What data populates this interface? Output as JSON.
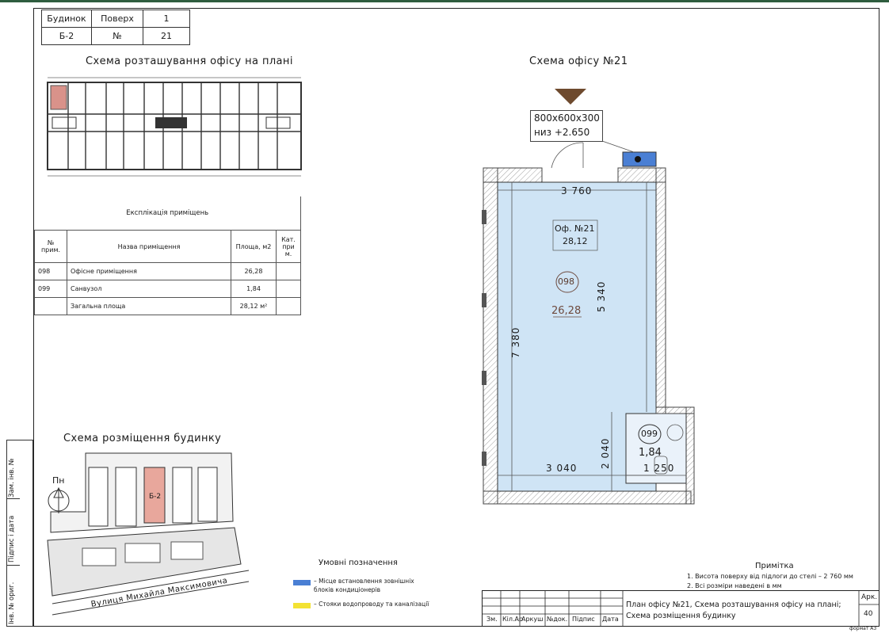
{
  "header": {
    "building_label": "Будинок",
    "building_value": "Б-2",
    "floor_label": "Поверх",
    "floor_value": "1",
    "number_label": "№",
    "number_value": "21"
  },
  "titles": {
    "floor_scheme": "Схема розташування офісу на плані",
    "office_scheme": "Схема офісу №21",
    "building_scheme": "Схема розміщення будинку"
  },
  "explication": {
    "caption": "Експлікація приміщень",
    "col_num": "№ прим.",
    "col_name": "Назва приміщення",
    "col_area": "Площа, м2",
    "col_cat": "Кат. при м.",
    "rows": [
      {
        "num": "098",
        "name": "Офісне приміщення",
        "area": "26,28"
      },
      {
        "num": "099",
        "name": "Санвузол",
        "area": "1,84"
      }
    ],
    "total_name": "Загальна площа",
    "total_area": "28,12 м²"
  },
  "office_plan": {
    "ac_unit_size": "800x600x300",
    "ac_unit_level": "низ +2.650",
    "office_label": "Оф. №21",
    "office_area": "28,12",
    "room_098_num": "098",
    "room_098_area": "26,28",
    "room_099_num": "099",
    "room_099_area": "1,84",
    "dim_top": "3 760",
    "dim_right": "5 340",
    "dim_left": "7 380",
    "dim_bottom": "3 040",
    "dim_wc_h": "2 040",
    "dim_wc_w": "1 250"
  },
  "site": {
    "north_label": "Пн",
    "building_tag": "Б-2",
    "street": "Вулиця Михайла Максимовича"
  },
  "legend": {
    "title": "Умовні позначення",
    "item_blue": "– Місце встановлення зовнішніх блоків кондиціонерів",
    "item_yellow": "– Стояки водопроводу та каналізації",
    "color_blue": "#4a7fd4",
    "color_yellow": "#f3e233"
  },
  "notes": {
    "title": "Примітка",
    "line1": "1. Висота поверху від підлоги до стелі – 2 760 мм",
    "line2": "2. Всі розміри наведені в мм"
  },
  "stamp": {
    "col_zm": "Зм.",
    "col_kil": "Кіл.Ар",
    "col_ark": "Аркуш",
    "col_doc": "№док.",
    "col_sign": "Підпис",
    "col_date": "Дата",
    "description": "План офісу №21, Схема розташування офісу на плані; Схема розміщення будинку",
    "sheet_label": "Арк.",
    "sheet_num": "40",
    "format": "формат А3"
  },
  "side_strip": {
    "inv_no": "Інв. № ориг.",
    "sign_date": "Підпис і дата",
    "zam_inv": "Зам. інв. №"
  }
}
